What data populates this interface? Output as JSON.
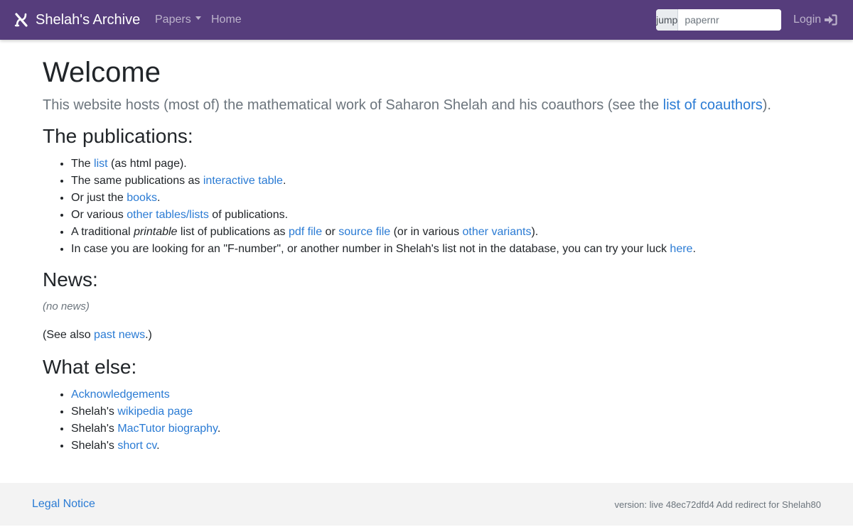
{
  "navbar": {
    "brand": "Shelah's Archive",
    "papers_label": "Papers",
    "home_label": "Home",
    "jump_label": "jump to",
    "jump_placeholder": "papernr",
    "jump_value": "",
    "login_label": "Login"
  },
  "main": {
    "title": "Welcome",
    "lead": {
      "text_before": "This website hosts (most of) the mathematical work of Saharon Shelah and his coauthors (see the ",
      "link": "list of coauthors",
      "text_after": ")."
    },
    "publications": {
      "heading": "The publications:",
      "items": [
        {
          "t1": "The ",
          "l1": "list",
          "t2": " (as html page)."
        },
        {
          "t1": "The same publications as ",
          "l1": "interactive table",
          "t2": "."
        },
        {
          "t1": "Or just the ",
          "l1": "books",
          "t2": "."
        },
        {
          "t1": "Or various ",
          "l1": "other tables/lists",
          "t2": " of publications."
        },
        {
          "t1": "A traditional ",
          "em": "printable",
          "t2": " list of publications as ",
          "l1": "pdf file",
          "t3": " or ",
          "l2": "source file",
          "t4": " (or in various ",
          "l3": "other variants",
          "t5": ")."
        },
        {
          "t1": "In case you are looking for an \"F-number\", or another number in Shelah's list not in the database, you can try your luck ",
          "l1": "here",
          "t2": "."
        }
      ]
    },
    "news": {
      "heading": "News:",
      "empty": "(no news)",
      "see_also_before": "(See also ",
      "see_also_link": "past news",
      "see_also_after": ".)"
    },
    "what_else": {
      "heading": "What else:",
      "items": [
        {
          "t1": "",
          "l1": "Acknowledgements",
          "t2": ""
        },
        {
          "t1": "Shelah's ",
          "l1": "wikipedia page",
          "t2": ""
        },
        {
          "t1": "Shelah's ",
          "l1": "MacTutor biography",
          "t2": "."
        },
        {
          "t1": "Shelah's ",
          "l1": "short cv",
          "t2": "."
        }
      ]
    }
  },
  "footer": {
    "legal": "Legal Notice",
    "version": "version: live 48ec72dfd4 Add redirect for Shelah80"
  },
  "colors": {
    "navbar_bg": "#563d7c",
    "link": "#2a7bd4",
    "text": "#212529",
    "muted": "#6c757d",
    "footer_bg": "#f3f3f3"
  },
  "icons": {
    "brand": "aleph-logo-icon",
    "papers_dropdown": "caret-down-icon",
    "login": "sign-in-icon"
  }
}
